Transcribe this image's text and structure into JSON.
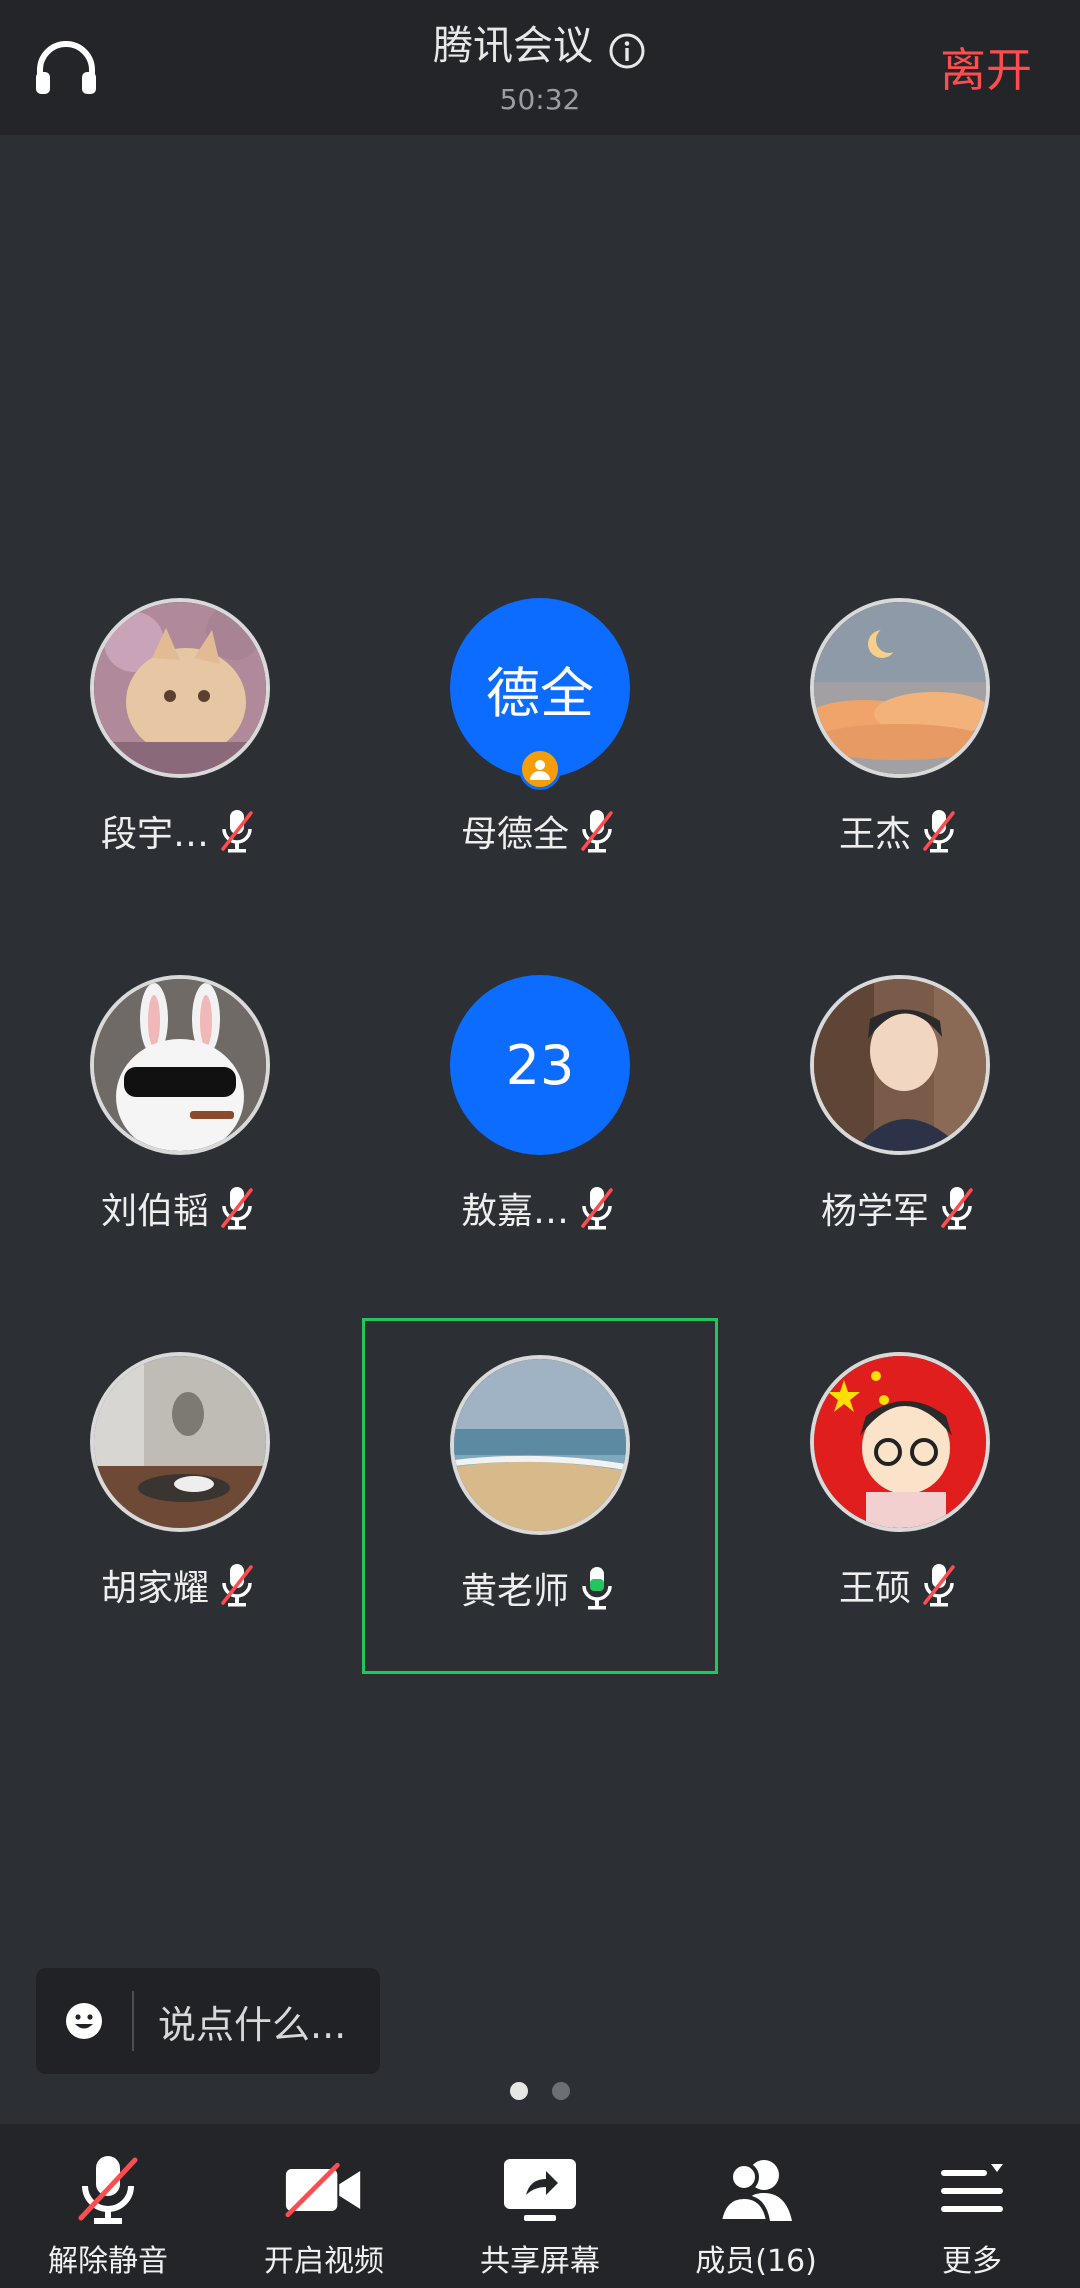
{
  "header": {
    "title": "腾讯会议",
    "timer": "50:32",
    "leave_label": "离开",
    "icons": {
      "audio": "headphones-icon",
      "info": "info-icon"
    }
  },
  "participants": [
    {
      "name": "段宇…",
      "avatar": "photo-cat",
      "mic": "muted"
    },
    {
      "name": "母德全",
      "avatar_text": "德全",
      "mic": "muted",
      "host": true
    },
    {
      "name": "王杰",
      "avatar": "photo-moon-clouds",
      "mic": "muted"
    },
    {
      "name": "刘伯韬",
      "avatar": "photo-rabbit-sunglasses",
      "mic": "muted"
    },
    {
      "name": "敖嘉…",
      "avatar_text": "23",
      "mic": "muted"
    },
    {
      "name": "杨学军",
      "avatar": "photo-young-man",
      "mic": "muted"
    },
    {
      "name": "胡家耀",
      "avatar": "photo-cat-room",
      "mic": "muted"
    },
    {
      "name": "黄老师",
      "avatar": "photo-beach",
      "mic": "active",
      "speaking": true
    },
    {
      "name": "王硕",
      "avatar": "photo-flag-cartoon",
      "mic": "muted"
    }
  ],
  "chat": {
    "placeholder": "说点什么..."
  },
  "pager": {
    "pages": 2,
    "current": 1
  },
  "toolbar": {
    "unmute": "解除静音",
    "video": "开启视频",
    "share": "共享屏幕",
    "members": "成员(16)",
    "more": "更多"
  },
  "colors": {
    "background": "#2c2f33",
    "bar": "#232528",
    "leave": "#ff4d4f",
    "avatar_blue": "#0b6cff",
    "speaking": "#22c55e",
    "mute_slash": "#ff4d4f"
  }
}
